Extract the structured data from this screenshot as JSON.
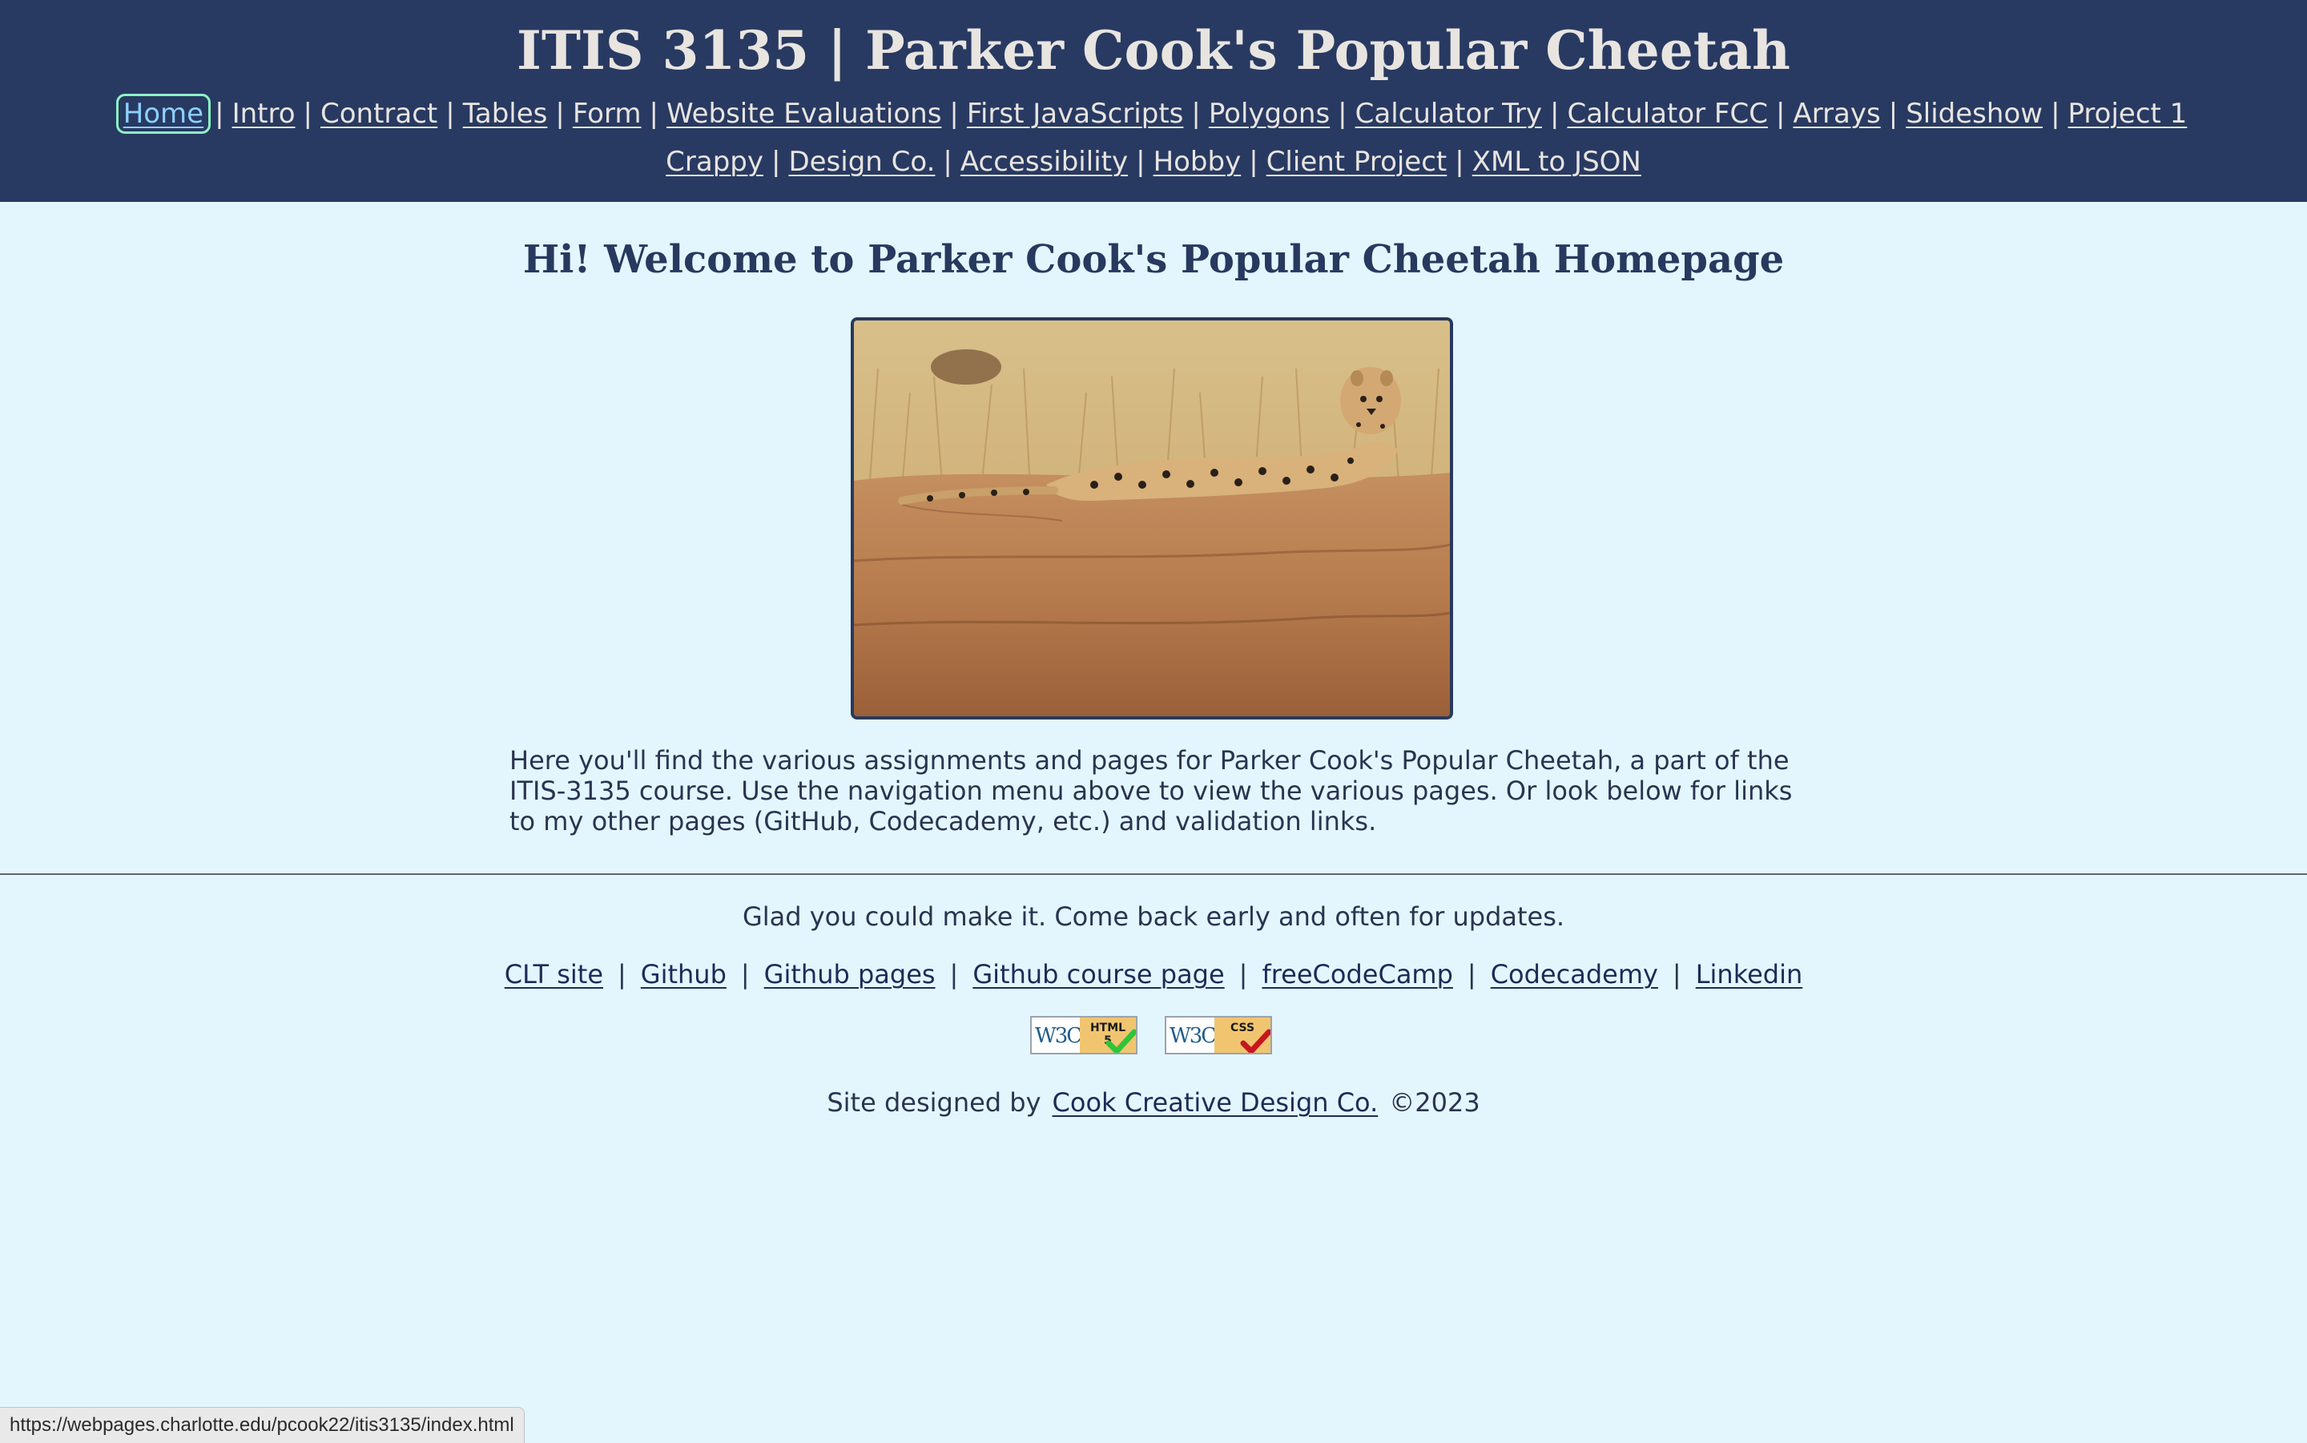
{
  "header": {
    "title": "ITIS 3135 | Parker Cook's Popular Cheetah",
    "nav": {
      "separator": "|",
      "row1": [
        {
          "label": "Home",
          "active": true
        },
        {
          "label": "Intro"
        },
        {
          "label": "Contract"
        },
        {
          "label": "Tables"
        },
        {
          "label": "Form"
        },
        {
          "label": "Website Evaluations"
        },
        {
          "label": "First JavaScripts"
        },
        {
          "label": "Polygons"
        },
        {
          "label": "Calculator Try"
        },
        {
          "label": "Calculator FCC"
        },
        {
          "label": "Arrays"
        },
        {
          "label": "Slideshow"
        },
        {
          "label": "Project 1"
        }
      ],
      "row2": [
        {
          "label": "Crappy"
        },
        {
          "label": "Design Co."
        },
        {
          "label": "Accessibility"
        },
        {
          "label": "Hobby"
        },
        {
          "label": "Client Project"
        },
        {
          "label": "XML to JSON"
        }
      ]
    }
  },
  "main": {
    "heading": "Hi! Welcome to Parker Cook's Popular Cheetah Homepage",
    "image": {
      "subject": "cheetah lying on a rock in savanna grass"
    },
    "intro": "Here you'll find the various assignments and pages for Parker Cook's Popular Cheetah, a part of the ITIS-3135 course. Use the navigation menu above to view the various pages. Or look below for links to my other pages (GitHub, Codecademy, etc.) and validation links."
  },
  "footer": {
    "tagline": "Glad you could make it. Come back early and often for updates.",
    "separator": "|",
    "links": [
      {
        "label": "CLT site"
      },
      {
        "label": "Github"
      },
      {
        "label": "Github pages"
      },
      {
        "label": "Github course page"
      },
      {
        "label": "freeCodeCamp"
      },
      {
        "label": "Codecademy"
      },
      {
        "label": "Linkedin"
      }
    ],
    "badges": {
      "html": {
        "w3c": "W3C",
        "tag_line1": "HTML",
        "tag_line2": "5",
        "check_color": "#2fc43a"
      },
      "css": {
        "w3c": "W3C",
        "tag_line1": "CSS",
        "check_color": "#c8161d"
      }
    },
    "credit": {
      "prefix": "Site designed by",
      "link": "Cook Creative Design Co.",
      "suffix": "©2023"
    }
  },
  "status_bar": {
    "url": "https://webpages.charlotte.edu/pcook22/itis3135/index.html"
  },
  "colors": {
    "header_bg": "#283a62",
    "page_bg": "#e3f6fe",
    "heading_text": "#27395e",
    "active_link": "#8dd0ff",
    "focus_ring": "#8df3c6"
  }
}
